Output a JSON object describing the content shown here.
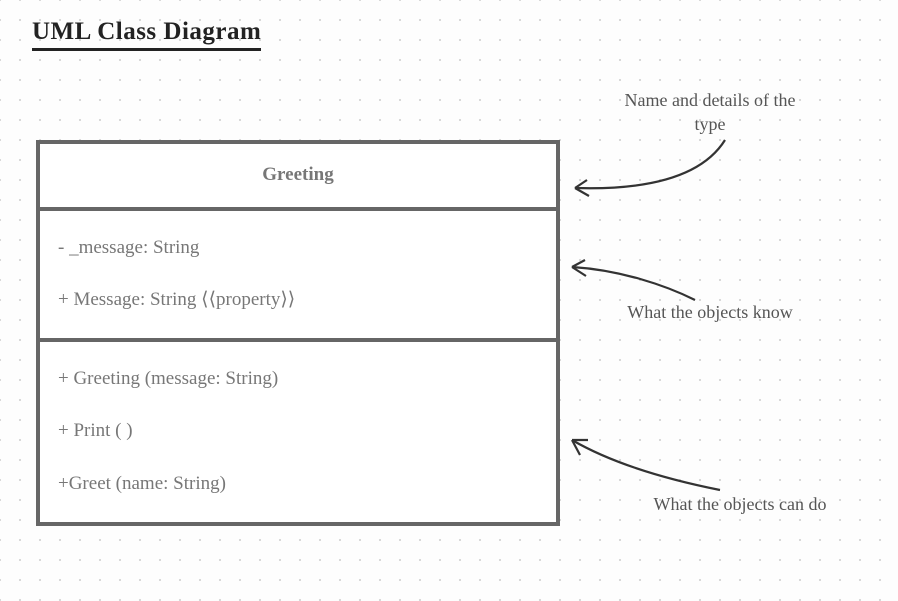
{
  "title": "UML Class Diagram",
  "uml": {
    "className": "Greeting",
    "fields": [
      "- _message: String",
      "+ Message: String ⟨⟨property⟩⟩"
    ],
    "methods": [
      "+ Greeting (message: String)",
      "+ Print ( )",
      "+Greet (name: String)"
    ]
  },
  "annotations": {
    "name": "Name and details of the type",
    "fields": "What the objects know",
    "methods": "What the objects can do"
  }
}
